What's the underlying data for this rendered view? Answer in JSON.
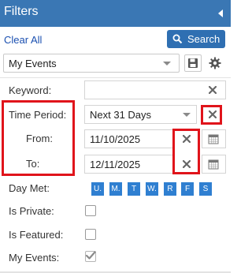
{
  "header": {
    "title": "Filters"
  },
  "toolbar": {
    "clear_all": "Clear All",
    "search_label": "Search"
  },
  "saved_filter": {
    "selected": "My Events"
  },
  "keyword": {
    "label": "Keyword:",
    "value": ""
  },
  "time_period": {
    "label": "Time Period:",
    "selected": "Next 31 Days"
  },
  "from": {
    "label": "From:",
    "value": "11/10/2025"
  },
  "to": {
    "label": "To:",
    "value": "12/11/2025"
  },
  "day_met": {
    "label": "Day Met:",
    "days": [
      "U.",
      "M.",
      "T",
      "W.",
      "R",
      "F",
      "S"
    ]
  },
  "is_private": {
    "label": "Is Private:",
    "checked": false
  },
  "is_featured": {
    "label": "Is Featured:",
    "checked": false
  },
  "my_events": {
    "label": "My Events:",
    "checked": true
  },
  "colors": {
    "header": "#3a77b4",
    "accent": "#2f6fb2",
    "highlight": "#e0141b",
    "day_button": "#2f7fd1"
  }
}
